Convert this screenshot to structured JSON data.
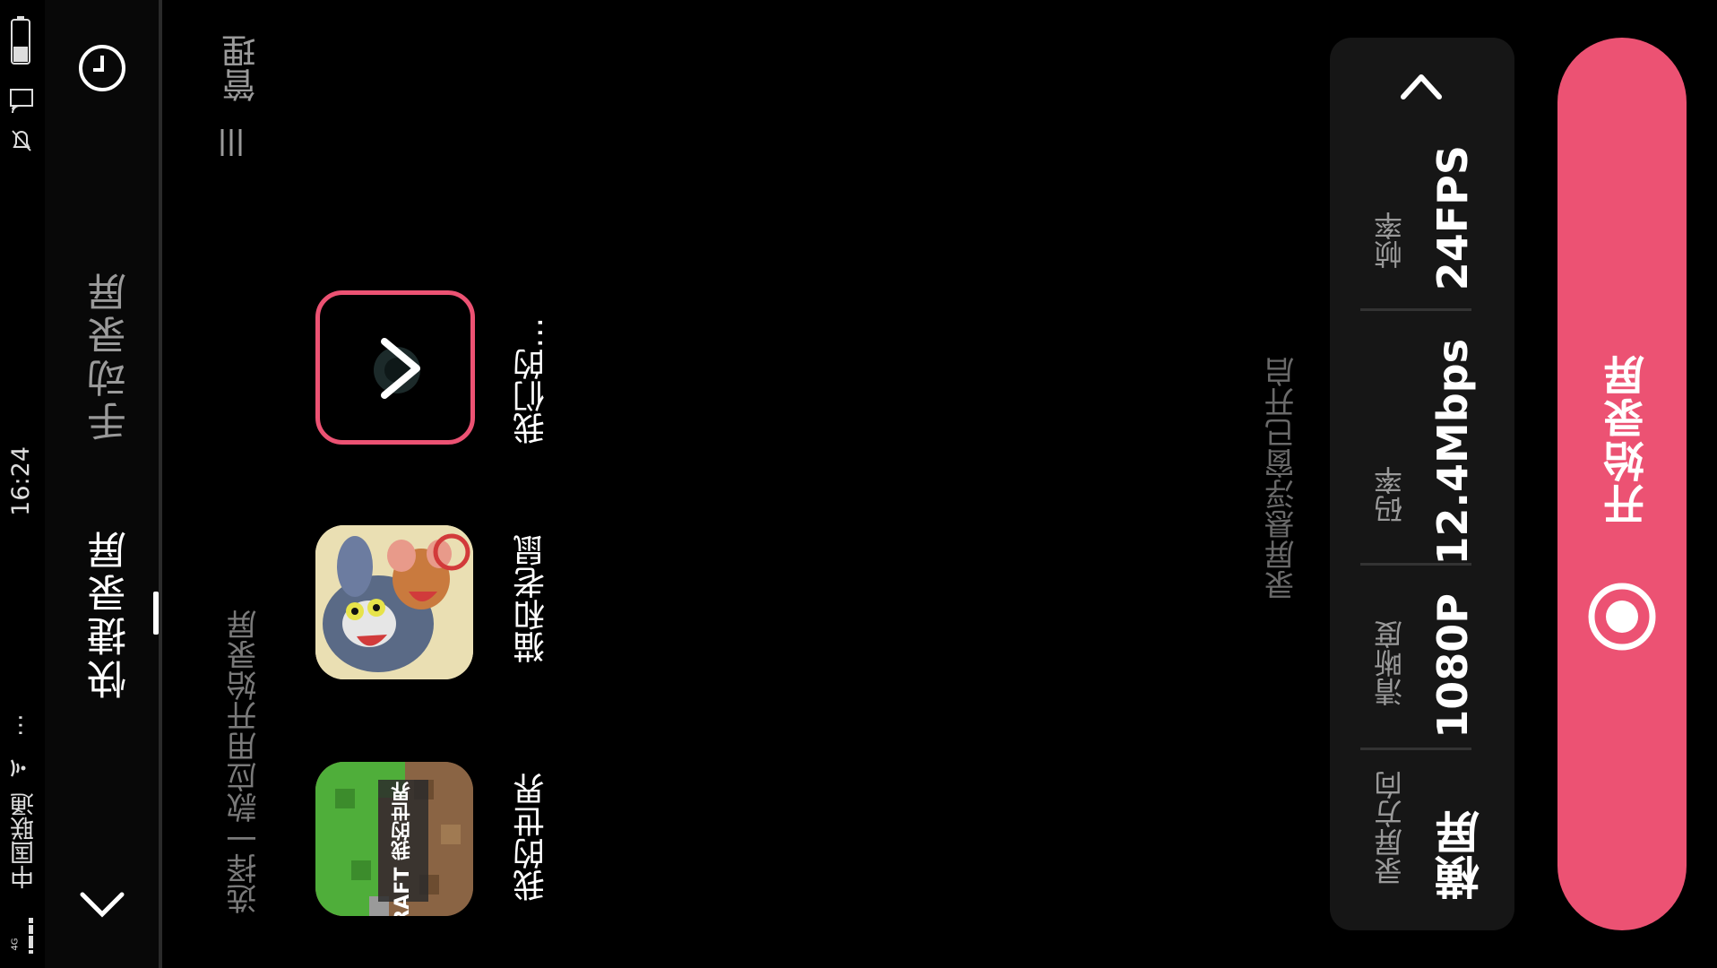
{
  "status_bar": {
    "time": "16:24",
    "carrier": "中国联通",
    "network": "4G",
    "more": "⋯"
  },
  "tabs": {
    "quick": "快捷录屏",
    "manual": "手动录屏"
  },
  "apps_section": {
    "hint": "选择一款应用开始录屏",
    "manage": "管理",
    "apps": [
      {
        "name": "我的世界",
        "icon": "minecraft-icon",
        "logo_text": "MINECRAFT 我的世界"
      },
      {
        "name": "猫和老鼠",
        "icon": "tom-and-jerry-icon"
      },
      {
        "name": "我们的...",
        "icon": "more-apps-icon"
      }
    ]
  },
  "floating_window_note": "录屏悬浮窗已开启",
  "settings": {
    "orientation": {
      "label": "录屏方向",
      "value": "横屏"
    },
    "resolution": {
      "label": "清晰度",
      "value": "1080P"
    },
    "bitrate": {
      "label": "码率",
      "value": "12.4Mbps"
    },
    "fps": {
      "label": "帧率",
      "value": "24FPS"
    }
  },
  "start_button": {
    "label": "开始录屏"
  },
  "colors": {
    "accent": "#ec5273",
    "background": "#000000",
    "card": "#161616"
  }
}
